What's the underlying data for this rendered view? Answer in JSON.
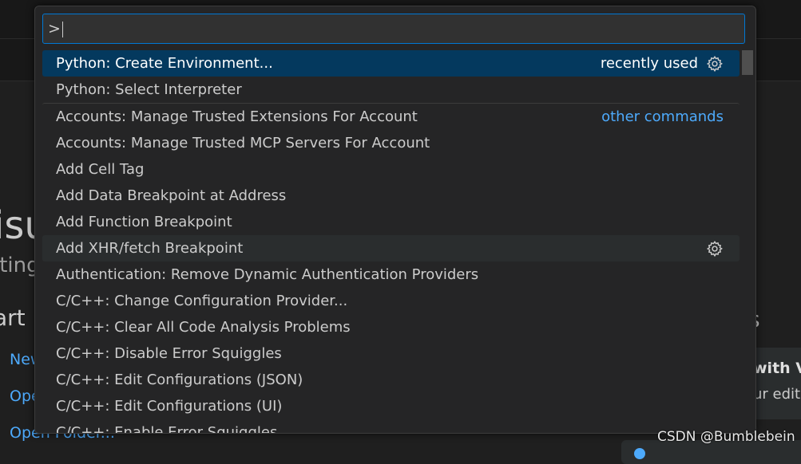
{
  "watermark": "CSDN @Bumblebein",
  "welcome": {
    "title_fragment": "isu",
    "subtitle_fragment": "iting",
    "start_fragment": "art",
    "links": [
      "New",
      "Ope",
      "Open Folder..."
    ],
    "right_heading_fragment": "s",
    "walkthrough_title_fragment": "with VS",
    "walkthrough_desc_fragment": "ur edito"
  },
  "palette": {
    "input_value": ">",
    "items": [
      {
        "label": "Python: Create Environment...",
        "tag": "recently used",
        "gear": true,
        "state": "selected"
      },
      {
        "label": "Python: Select Interpreter"
      },
      {
        "label": "Accounts: Manage Trusted Extensions For Account",
        "link": "other commands",
        "separator": true
      },
      {
        "label": "Accounts: Manage Trusted MCP Servers For Account"
      },
      {
        "label": "Add Cell Tag"
      },
      {
        "label": "Add Data Breakpoint at Address"
      },
      {
        "label": "Add Function Breakpoint"
      },
      {
        "label": "Add XHR/fetch Breakpoint",
        "gear": true,
        "state": "hovered"
      },
      {
        "label": "Authentication: Remove Dynamic Authentication Providers"
      },
      {
        "label": "C/C++: Change Configuration Provider..."
      },
      {
        "label": "C/C++: Clear All Code Analysis Problems"
      },
      {
        "label": "C/C++: Disable Error Squiggles"
      },
      {
        "label": "C/C++: Edit Configurations (JSON)"
      },
      {
        "label": "C/C++: Edit Configurations (UI)"
      },
      {
        "label": "C/C++: Enable Error Squiggles"
      }
    ]
  }
}
